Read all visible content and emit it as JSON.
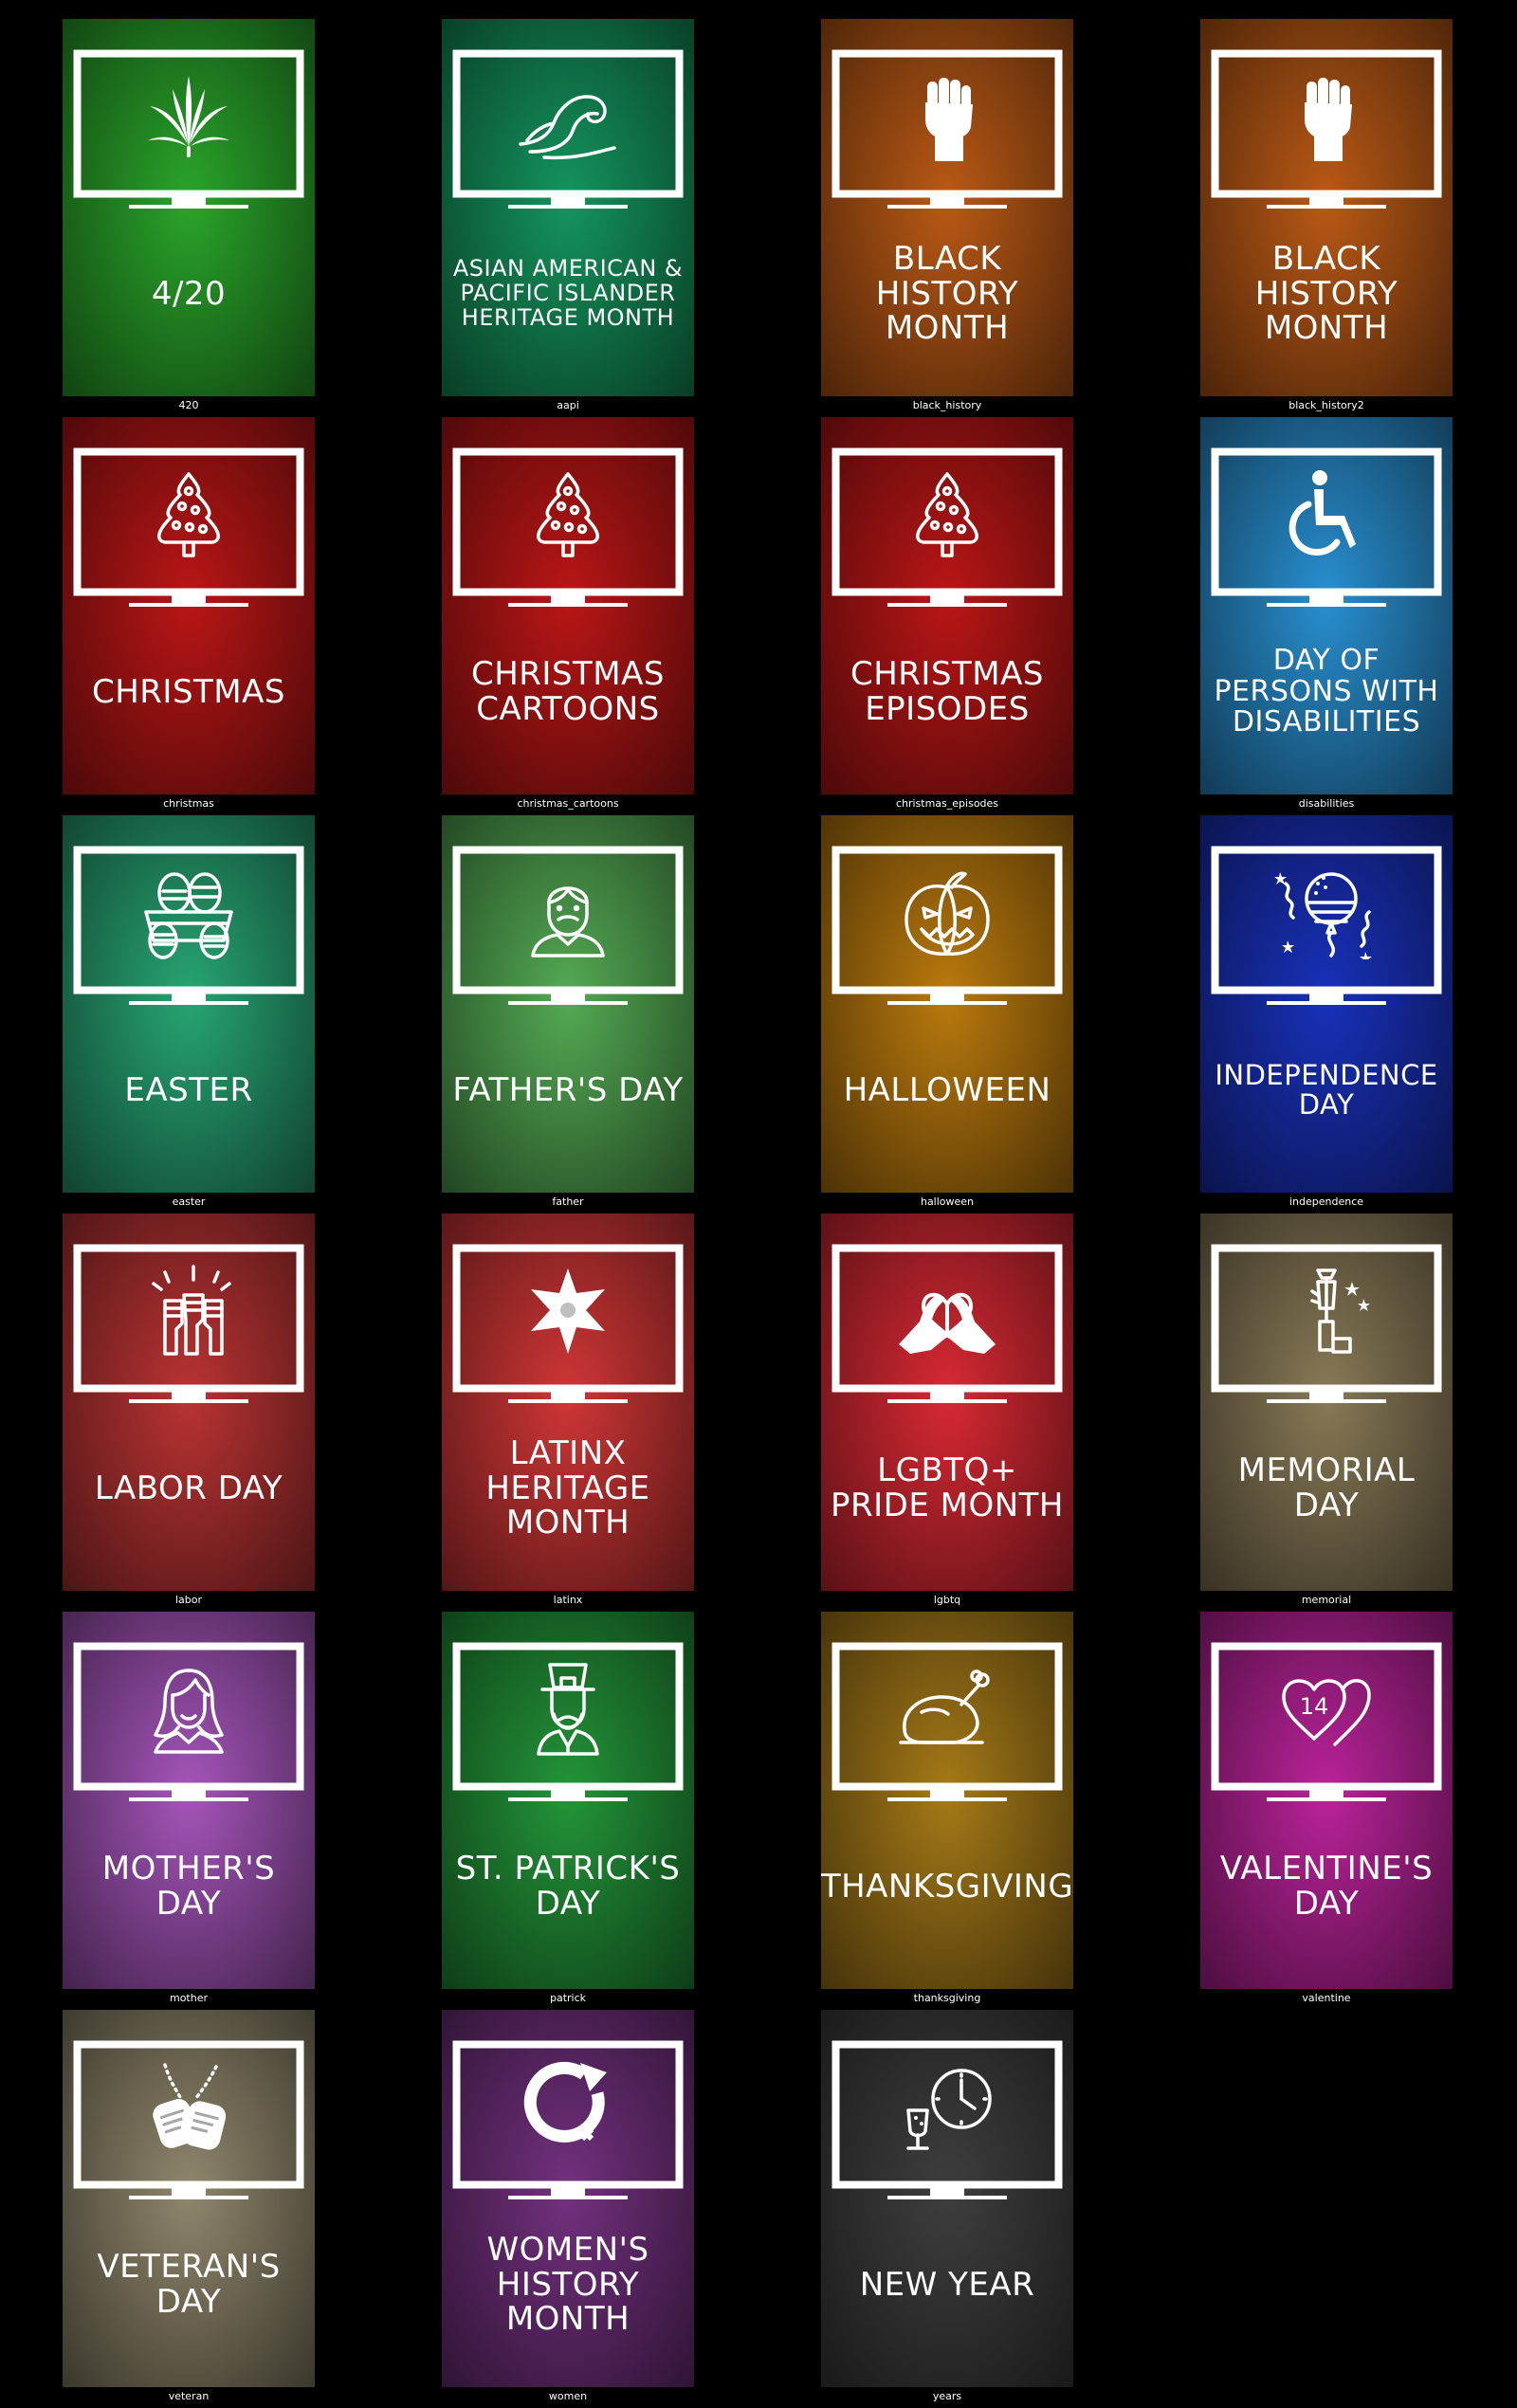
{
  "posters": [
    {
      "title": "4/20",
      "caption": "420",
      "icon": "cannabis-leaf-icon",
      "color": "#1f7a1f",
      "size": 34
    },
    {
      "title": "ASIAN AMERICAN & PACIFIC ISLANDER HERITAGE MONTH",
      "caption": "aapi",
      "icon": "wave-icon",
      "color": "#0f6e45",
      "size": 24
    },
    {
      "title": "BLACK HISTORY MONTH",
      "caption": "black_history",
      "icon": "raised-fist-icon",
      "color": "#8a4210",
      "size": 34
    },
    {
      "title": "BLACK HISTORY MONTH",
      "caption": "black_history2",
      "icon": "raised-fist-icon",
      "color": "#8a4210",
      "size": 34
    },
    {
      "title": "CHRISTMAS",
      "caption": "christmas",
      "icon": "christmas-tree-icon",
      "color": "#8a1010",
      "size": 34
    },
    {
      "title": "CHRISTMAS CARTOONS",
      "caption": "christmas_cartoons",
      "icon": "christmas-tree-icon",
      "color": "#8a1010",
      "size": 34
    },
    {
      "title": "CHRISTMAS EPISODES",
      "caption": "christmas_episodes",
      "icon": "christmas-tree-icon",
      "color": "#8a1010",
      "size": 34
    },
    {
      "title": "DAY OF PERSONS WITH DISABILITIES",
      "caption": "disabilities",
      "icon": "wheelchair-icon",
      "color": "#1e6a9a",
      "size": 30
    },
    {
      "title": "EASTER",
      "caption": "easter",
      "icon": "easter-eggs-basket-icon",
      "color": "#1d7a55",
      "size": 34
    },
    {
      "title": "FATHER'S DAY",
      "caption": "father",
      "icon": "father-icon",
      "color": "#3e7e3e",
      "size": 34
    },
    {
      "title": "HALLOWEEN",
      "caption": "halloween",
      "icon": "jack-o-lantern-icon",
      "color": "#8a5a0a",
      "size": 34
    },
    {
      "title": "INDEPENDENCE DAY",
      "caption": "independence",
      "icon": "flag-balloon-icon",
      "color": "#12248a",
      "size": 29
    },
    {
      "title": "LABOR DAY",
      "caption": "labor",
      "icon": "raised-fists-icon",
      "color": "#8a2626",
      "size": 34
    },
    {
      "title": "LATINX HERITAGE MONTH",
      "caption": "latinx",
      "icon": "pinata-star-icon",
      "color": "#9a2828",
      "size": 34
    },
    {
      "title": "LGBTQ+ PRIDE MONTH",
      "caption": "lgbtq",
      "icon": "heart-hands-icon",
      "color": "#a01e26",
      "size": 34
    },
    {
      "title": "MEMORIAL DAY",
      "caption": "memorial",
      "icon": "soldier-memorial-icon",
      "color": "#655a40",
      "size": 34
    },
    {
      "title": "MOTHER'S DAY",
      "caption": "mother",
      "icon": "mother-icon",
      "color": "#7a3f8a",
      "size": 34
    },
    {
      "title": "ST. PATRICK'S DAY",
      "caption": "patrick",
      "icon": "leprechaun-icon",
      "color": "#1a6e2a",
      "size": 34
    },
    {
      "title": "THANKSGIVING",
      "caption": "thanksgiving",
      "icon": "roast-turkey-icon",
      "color": "#7a5a12",
      "size": 34
    },
    {
      "title": "VALENTINE'S DAY",
      "caption": "valentine",
      "icon": "hearts-14-icon",
      "color": "#8a1a72",
      "size": 34
    },
    {
      "title": "VETERAN'S DAY",
      "caption": "veteran",
      "icon": "dog-tags-icon",
      "color": "#6a6450",
      "size": 34
    },
    {
      "title": "WOMEN'S HISTORY MONTH",
      "caption": "women",
      "icon": "women-history-symbol-icon",
      "color": "#55245e",
      "size": 34
    },
    {
      "title": "NEW YEAR",
      "caption": "years",
      "icon": "clock-champagne-icon",
      "color": "#2e2e2e",
      "size": 34
    }
  ]
}
